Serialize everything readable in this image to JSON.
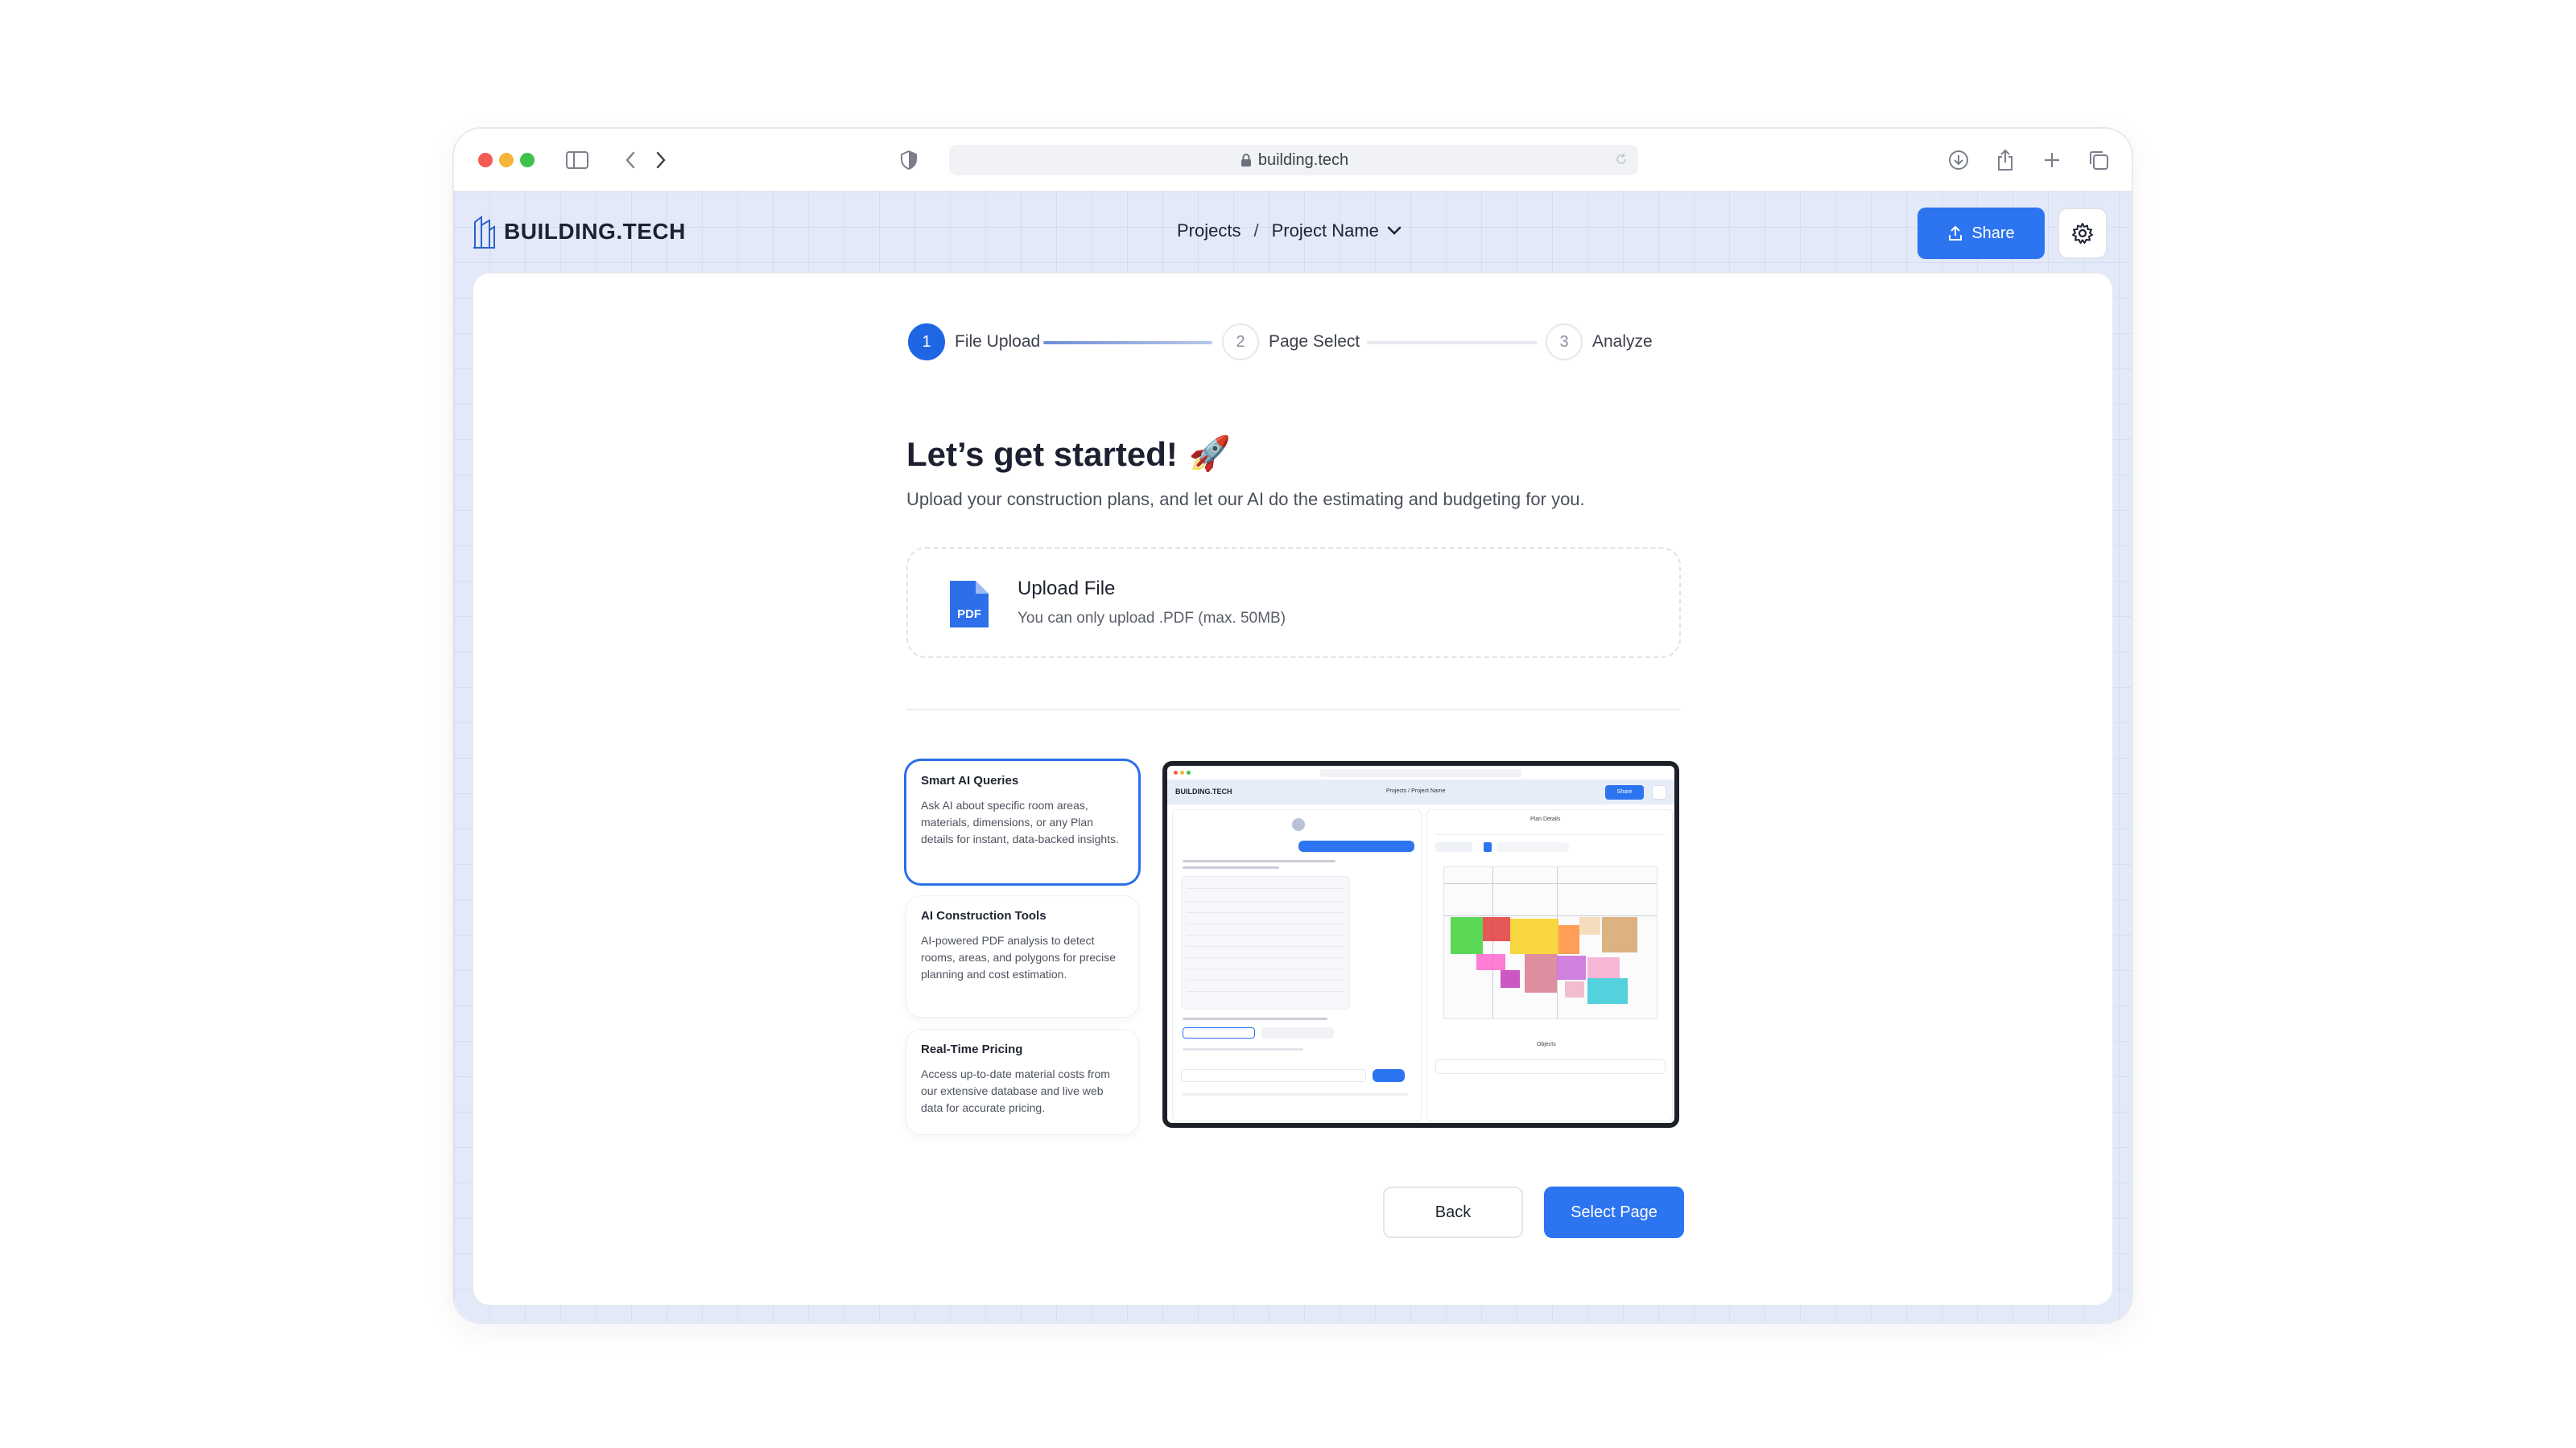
{
  "browser": {
    "url": "building.tech"
  },
  "header": {
    "logo_text": "BUILDING.T",
    "logo_text_mid": "E",
    "logo_text_end": "CH",
    "breadcrumb_root": "Projects",
    "breadcrumb_sep": "/",
    "breadcrumb_current": "Project Name",
    "share_label": "Share"
  },
  "stepper": {
    "steps": [
      {
        "num": "1",
        "label": "File Upload"
      },
      {
        "num": "2",
        "label": "Page Select"
      },
      {
        "num": "3",
        "label": "Analyze"
      }
    ]
  },
  "main": {
    "title": "Let’s get started!",
    "title_emoji": "🚀",
    "subtitle": "Upload your construction plans, and let our AI do the estimating and budgeting for you."
  },
  "upload": {
    "title": "Upload File",
    "subtitle": "You can only upload .PDF (max. 50MB)",
    "icon_label": "PDF"
  },
  "features": [
    {
      "title": "Smart AI Queries",
      "desc": "Ask AI about specific room areas, materials, dimensions, or any Plan details for instant, data-backed insights."
    },
    {
      "title": "AI Construction Tools",
      "desc": "AI-powered PDF analysis to detect rooms, areas, and polygons for precise planning and cost estimation."
    },
    {
      "title": "Real-Time Pricing",
      "desc": "Access up-to-date material costs from our extensive database and live web data for accurate pricing."
    }
  ],
  "preview": {
    "logo": "BUILDING.TECH",
    "crumbs": "Projects  /  Project Name",
    "share": "Share",
    "plan_title": "Plan Details",
    "objects_title": "Objects"
  },
  "actions": {
    "back_label": "Back",
    "select_label": "Select Page"
  },
  "colors": {
    "accent": "#2c74f0",
    "step_active": "#1f66e5",
    "header_bg": "#e3e9f8"
  }
}
